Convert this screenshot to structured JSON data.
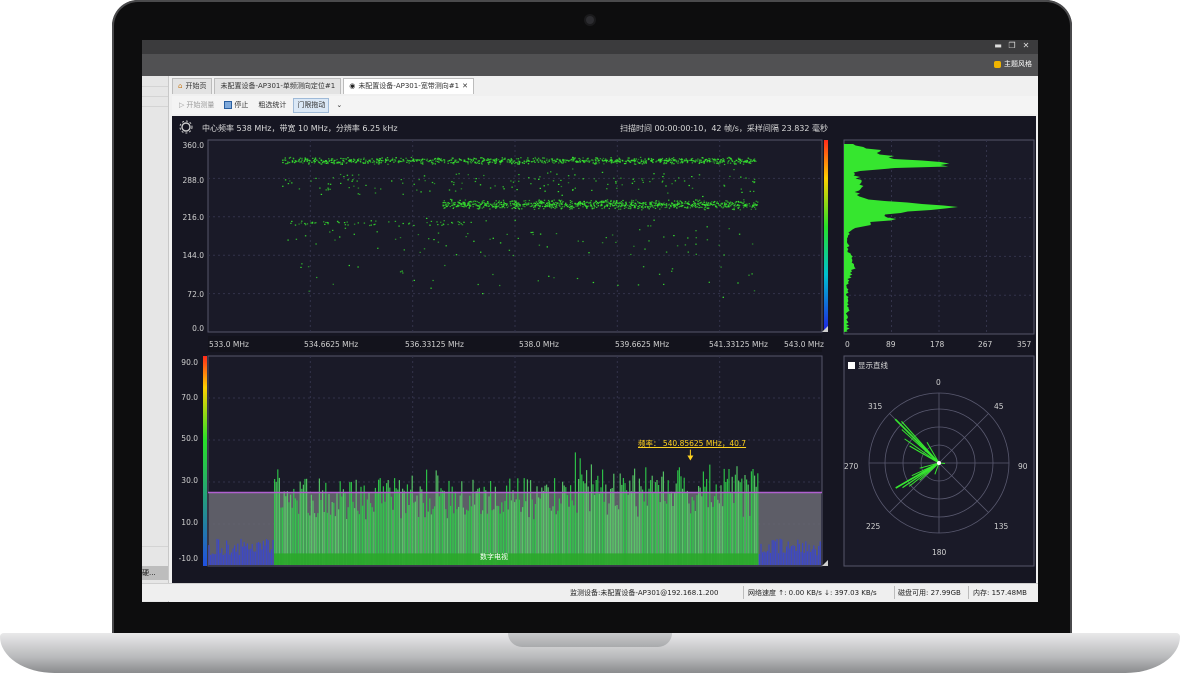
{
  "window": {
    "theme_label": "主题风格"
  },
  "tabs": [
    {
      "label": "开始页",
      "icon": "home-icon"
    },
    {
      "label": "未配置设备-AP301-单频测向定位#1",
      "icon": ""
    },
    {
      "label": "未配置设备-AP301-宽带测向#1",
      "icon": "record-icon"
    }
  ],
  "left_panel": {
    "tag": "硬..."
  },
  "toolbar": {
    "start": "开始测量",
    "stop": "停止",
    "stats": "粗选统计",
    "threshold": "门限拖动"
  },
  "info": {
    "left": "中心频率 538 MHz，带宽 10 MHz，分辨率 6.25 kHz",
    "right": "扫描时间 00:00:00:10，42 帧/s，采样间隔 23.832 毫秒"
  },
  "colors": {
    "signal": "#36e62f",
    "threshold": "#b060d0",
    "bg": "#161622",
    "marker": "#ffd21e"
  },
  "waterfall": {
    "type": "scatter",
    "y_ticks": [
      "360.0",
      "288.0",
      "216.0",
      "144.0",
      "72.0",
      "0.0"
    ],
    "ylim": [
      0,
      360
    ],
    "x_ticks": [
      "533.0 MHz",
      "534.6625 MHz",
      "536.33125 MHz",
      "538.0 MHz",
      "539.6625 MHz",
      "541.33125 MHz",
      "543.0 MHz"
    ],
    "xlim": [
      533.0,
      543.0
    ]
  },
  "histogram": {
    "x_ticks": [
      "0",
      "89",
      "178",
      "267",
      "357"
    ]
  },
  "spectrum": {
    "type": "area",
    "y_ticks": [
      "90.0",
      "70.0",
      "50.0",
      "30.0",
      "10.0",
      "-10.0"
    ],
    "ylim": [
      -10,
      90
    ],
    "threshold": 25,
    "band_label": "数字电视",
    "marker_label": "频率： 540.85625 MHz，40.7",
    "marker_freq": 540.85625,
    "marker_level": 40.7
  },
  "polar": {
    "checkbox_label": "显示直线",
    "angle_labels": [
      "0",
      "45",
      "90",
      "135",
      "180",
      "225",
      "270",
      "315"
    ]
  },
  "status": {
    "device": "监测设备:未配置设备-AP301@192.168.1.200",
    "network": "网络速度 ↑: 0.00 KB/s ↓: 397.03 KB/s",
    "disk": "磁盘可用: 27.99GB",
    "memory": "内存: 157.48MB"
  }
}
